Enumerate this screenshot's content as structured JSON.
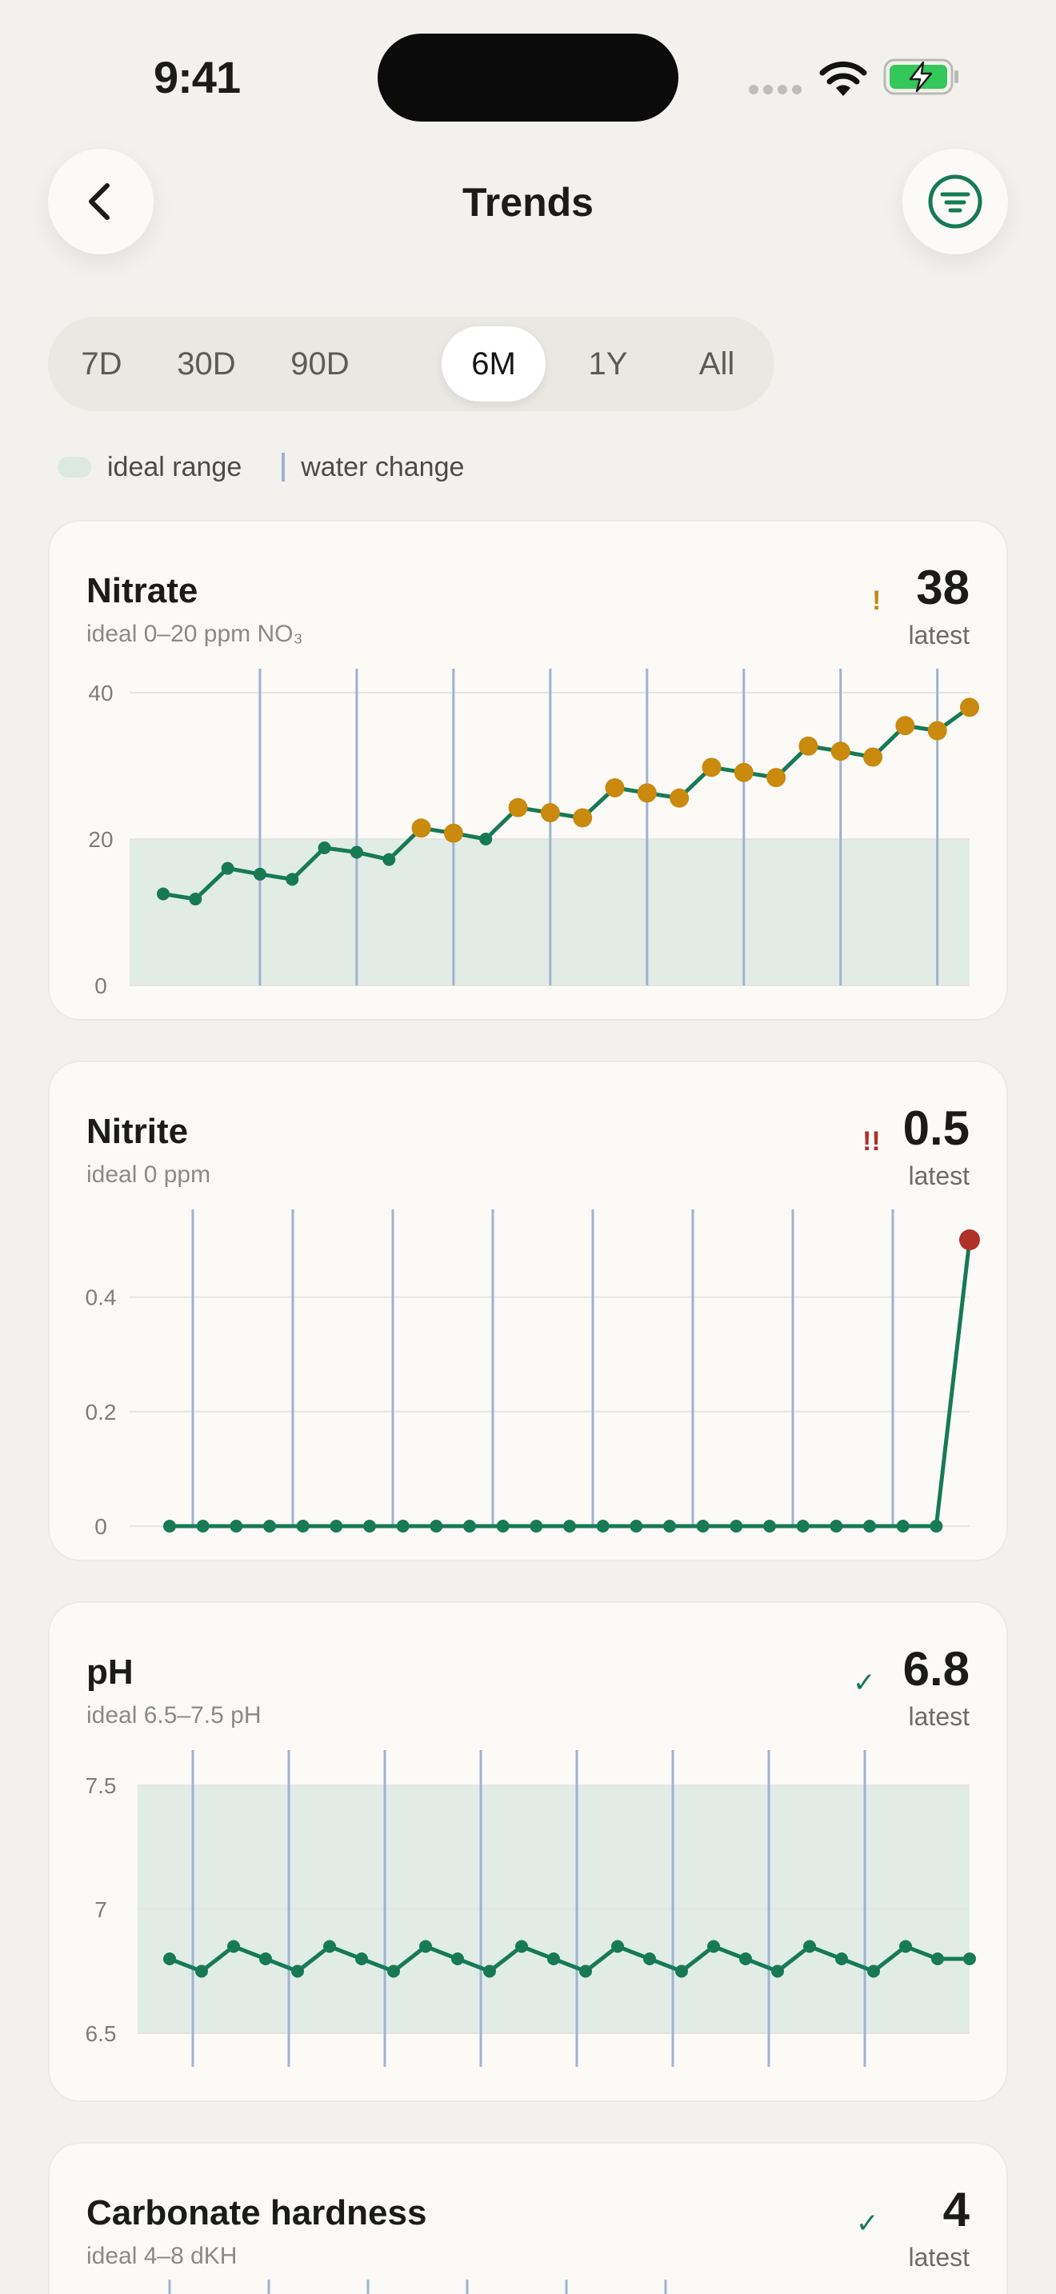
{
  "status_bar": {
    "time": "9:41"
  },
  "header": {
    "title": "Trends"
  },
  "ranges": [
    {
      "label": "7D",
      "active": false
    },
    {
      "label": "30D",
      "active": false
    },
    {
      "label": "90D",
      "active": false
    },
    {
      "label": "6M",
      "active": true
    },
    {
      "label": "1Y",
      "active": false
    },
    {
      "label": "All",
      "active": false
    }
  ],
  "legend": {
    "ideal": "ideal range",
    "water": "water change"
  },
  "colors": {
    "ok": "#177a54",
    "warn": "#c98a0e",
    "danger": "#b0302a",
    "range": "#e2ece7",
    "water_change": "#9eb2d0"
  },
  "cards": [
    {
      "name": "Nitrate",
      "ideal": "ideal 0–20 ppm NO₃",
      "value": "38",
      "latest": "latest",
      "flag": "!",
      "flag_color": "#c98a0e"
    },
    {
      "name": "Nitrite",
      "ideal": "ideal 0 ppm",
      "value": "0.5",
      "latest": "latest",
      "flag": "!!",
      "flag_color": "#b0302a"
    },
    {
      "name": "pH",
      "ideal": "ideal 6.5–7.5 pH",
      "value": "6.8",
      "latest": "latest",
      "flag": "✓",
      "flag_color": "#177a54"
    },
    {
      "name": "Carbonate hardness",
      "ideal": "ideal 4–8 dKH",
      "value": "4",
      "latest": "latest",
      "flag": "✓",
      "flag_color": "#177a54"
    }
  ],
  "chart_data": [
    {
      "type": "line",
      "title": "Nitrate",
      "y_ticks": [
        "0",
        "20",
        "40"
      ],
      "ylim": [
        0,
        40
      ],
      "ideal_range": [
        0,
        20
      ],
      "water_changes": [
        3,
        6,
        9,
        12,
        15,
        18,
        21,
        24
      ],
      "values": [
        12.5,
        11.8,
        16,
        15.2,
        14.5,
        18.8,
        18.2,
        17.2,
        21.5,
        20.8,
        20,
        24.3,
        23.6,
        22.9,
        27,
        26.3,
        25.6,
        29.8,
        29.1,
        28.4,
        32.7,
        32,
        31.2,
        35.5,
        34.8,
        38
      ]
    },
    {
      "type": "line",
      "title": "Nitrite",
      "y_ticks": [
        "0",
        "0.2",
        "0.4"
      ],
      "ylim": [
        0,
        0.5
      ],
      "ideal_range": [
        0,
        0
      ],
      "water_changes": [
        0,
        3,
        6,
        9,
        12,
        15,
        18,
        21
      ],
      "values": [
        0,
        0,
        0,
        0,
        0,
        0,
        0,
        0,
        0,
        0,
        0,
        0,
        0,
        0,
        0,
        0,
        0,
        0,
        0,
        0,
        0,
        0,
        0,
        0,
        0.5
      ]
    },
    {
      "type": "line",
      "title": "pH",
      "y_ticks": [
        "6.5",
        "7",
        "7.5"
      ],
      "ylim": [
        6.5,
        7.5
      ],
      "ideal_range": [
        6.5,
        7.5
      ],
      "water_changes": [
        0,
        3,
        6,
        9,
        12,
        15,
        18,
        21
      ],
      "values": [
        6.8,
        6.75,
        6.85,
        6.8,
        6.75,
        6.85,
        6.8,
        6.75,
        6.85,
        6.8,
        6.75,
        6.85,
        6.8,
        6.75,
        6.85,
        6.8,
        6.75,
        6.85,
        6.8,
        6.75,
        6.85,
        6.8,
        6.75,
        6.85,
        6.8,
        6.8
      ]
    }
  ]
}
